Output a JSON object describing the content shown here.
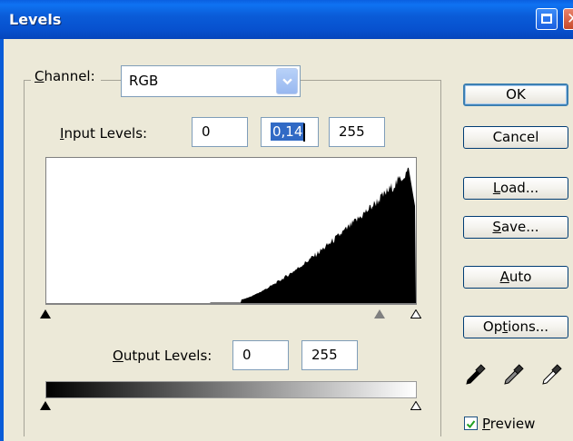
{
  "window": {
    "title": "Levels"
  },
  "channel": {
    "label": "Channel:",
    "value": "RGB"
  },
  "input_levels": {
    "label": "Input Levels:",
    "black": "0",
    "gamma": "0,14",
    "white": "255"
  },
  "output_levels": {
    "label": "Output Levels:",
    "black": "0",
    "white": "255"
  },
  "buttons": {
    "ok": "OK",
    "cancel": "Cancel",
    "load": "Load...",
    "save": "Save...",
    "auto": "Auto",
    "options": "Options..."
  },
  "preview": {
    "label": "Preview",
    "checked": true
  },
  "icons": [
    "maximize-icon",
    "close-icon",
    "dropdown-chevron-icon",
    "black-eyedropper-icon",
    "gray-eyedropper-icon",
    "white-eyedropper-icon",
    "checkmark-icon"
  ]
}
